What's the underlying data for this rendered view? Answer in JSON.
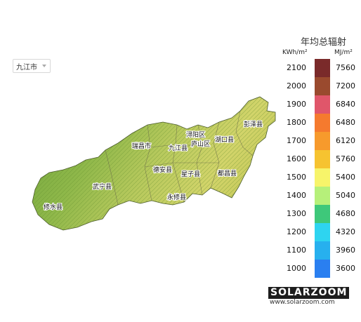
{
  "selector": {
    "value": "九江市"
  },
  "legend": {
    "title": "年均总辐射",
    "unit_left": "KWh/m²",
    "unit_right": "MJ/m²",
    "rows": [
      {
        "kwh": "2100",
        "mj": "7560",
        "color": "#7a2a2a"
      },
      {
        "kwh": "2000",
        "mj": "7200",
        "color": "#9a4a2e"
      },
      {
        "kwh": "1900",
        "mj": "6840",
        "color": "#e0566a"
      },
      {
        "kwh": "1800",
        "mj": "6480",
        "color": "#f57a2e"
      },
      {
        "kwh": "1700",
        "mj": "6120",
        "color": "#f79a2c"
      },
      {
        "kwh": "1600",
        "mj": "5760",
        "color": "#f6c330"
      },
      {
        "kwh": "1500",
        "mj": "5400",
        "color": "#f7f46a"
      },
      {
        "kwh": "1400",
        "mj": "5040",
        "color": "#b6f07a"
      },
      {
        "kwh": "1300",
        "mj": "4680",
        "color": "#3ec87a"
      },
      {
        "kwh": "1200",
        "mj": "4320",
        "color": "#2ed4f0"
      },
      {
        "kwh": "1100",
        "mj": "3960",
        "color": "#27b0ee"
      },
      {
        "kwh": "1000",
        "mj": "3600",
        "color": "#2a7ff0"
      }
    ]
  },
  "counties": [
    {
      "id": "pengze",
      "label": "彭泽县"
    },
    {
      "id": "xunyang",
      "label": "浔阳区"
    },
    {
      "id": "lushan",
      "label": "庐山区"
    },
    {
      "id": "hukou",
      "label": "湖口县"
    },
    {
      "id": "ruichang",
      "label": "瑞昌市"
    },
    {
      "id": "jiujiang",
      "label": "九江县"
    },
    {
      "id": "dean",
      "label": "德安县"
    },
    {
      "id": "xingzi",
      "label": "星子县"
    },
    {
      "id": "duchang",
      "label": "都昌县"
    },
    {
      "id": "wuning",
      "label": "武宁县"
    },
    {
      "id": "yongxiu",
      "label": "永修县"
    },
    {
      "id": "xiushui",
      "label": "修水县"
    }
  ],
  "logo": {
    "brand": "SOLARZOOM",
    "url": "www.solarzoom.com"
  }
}
